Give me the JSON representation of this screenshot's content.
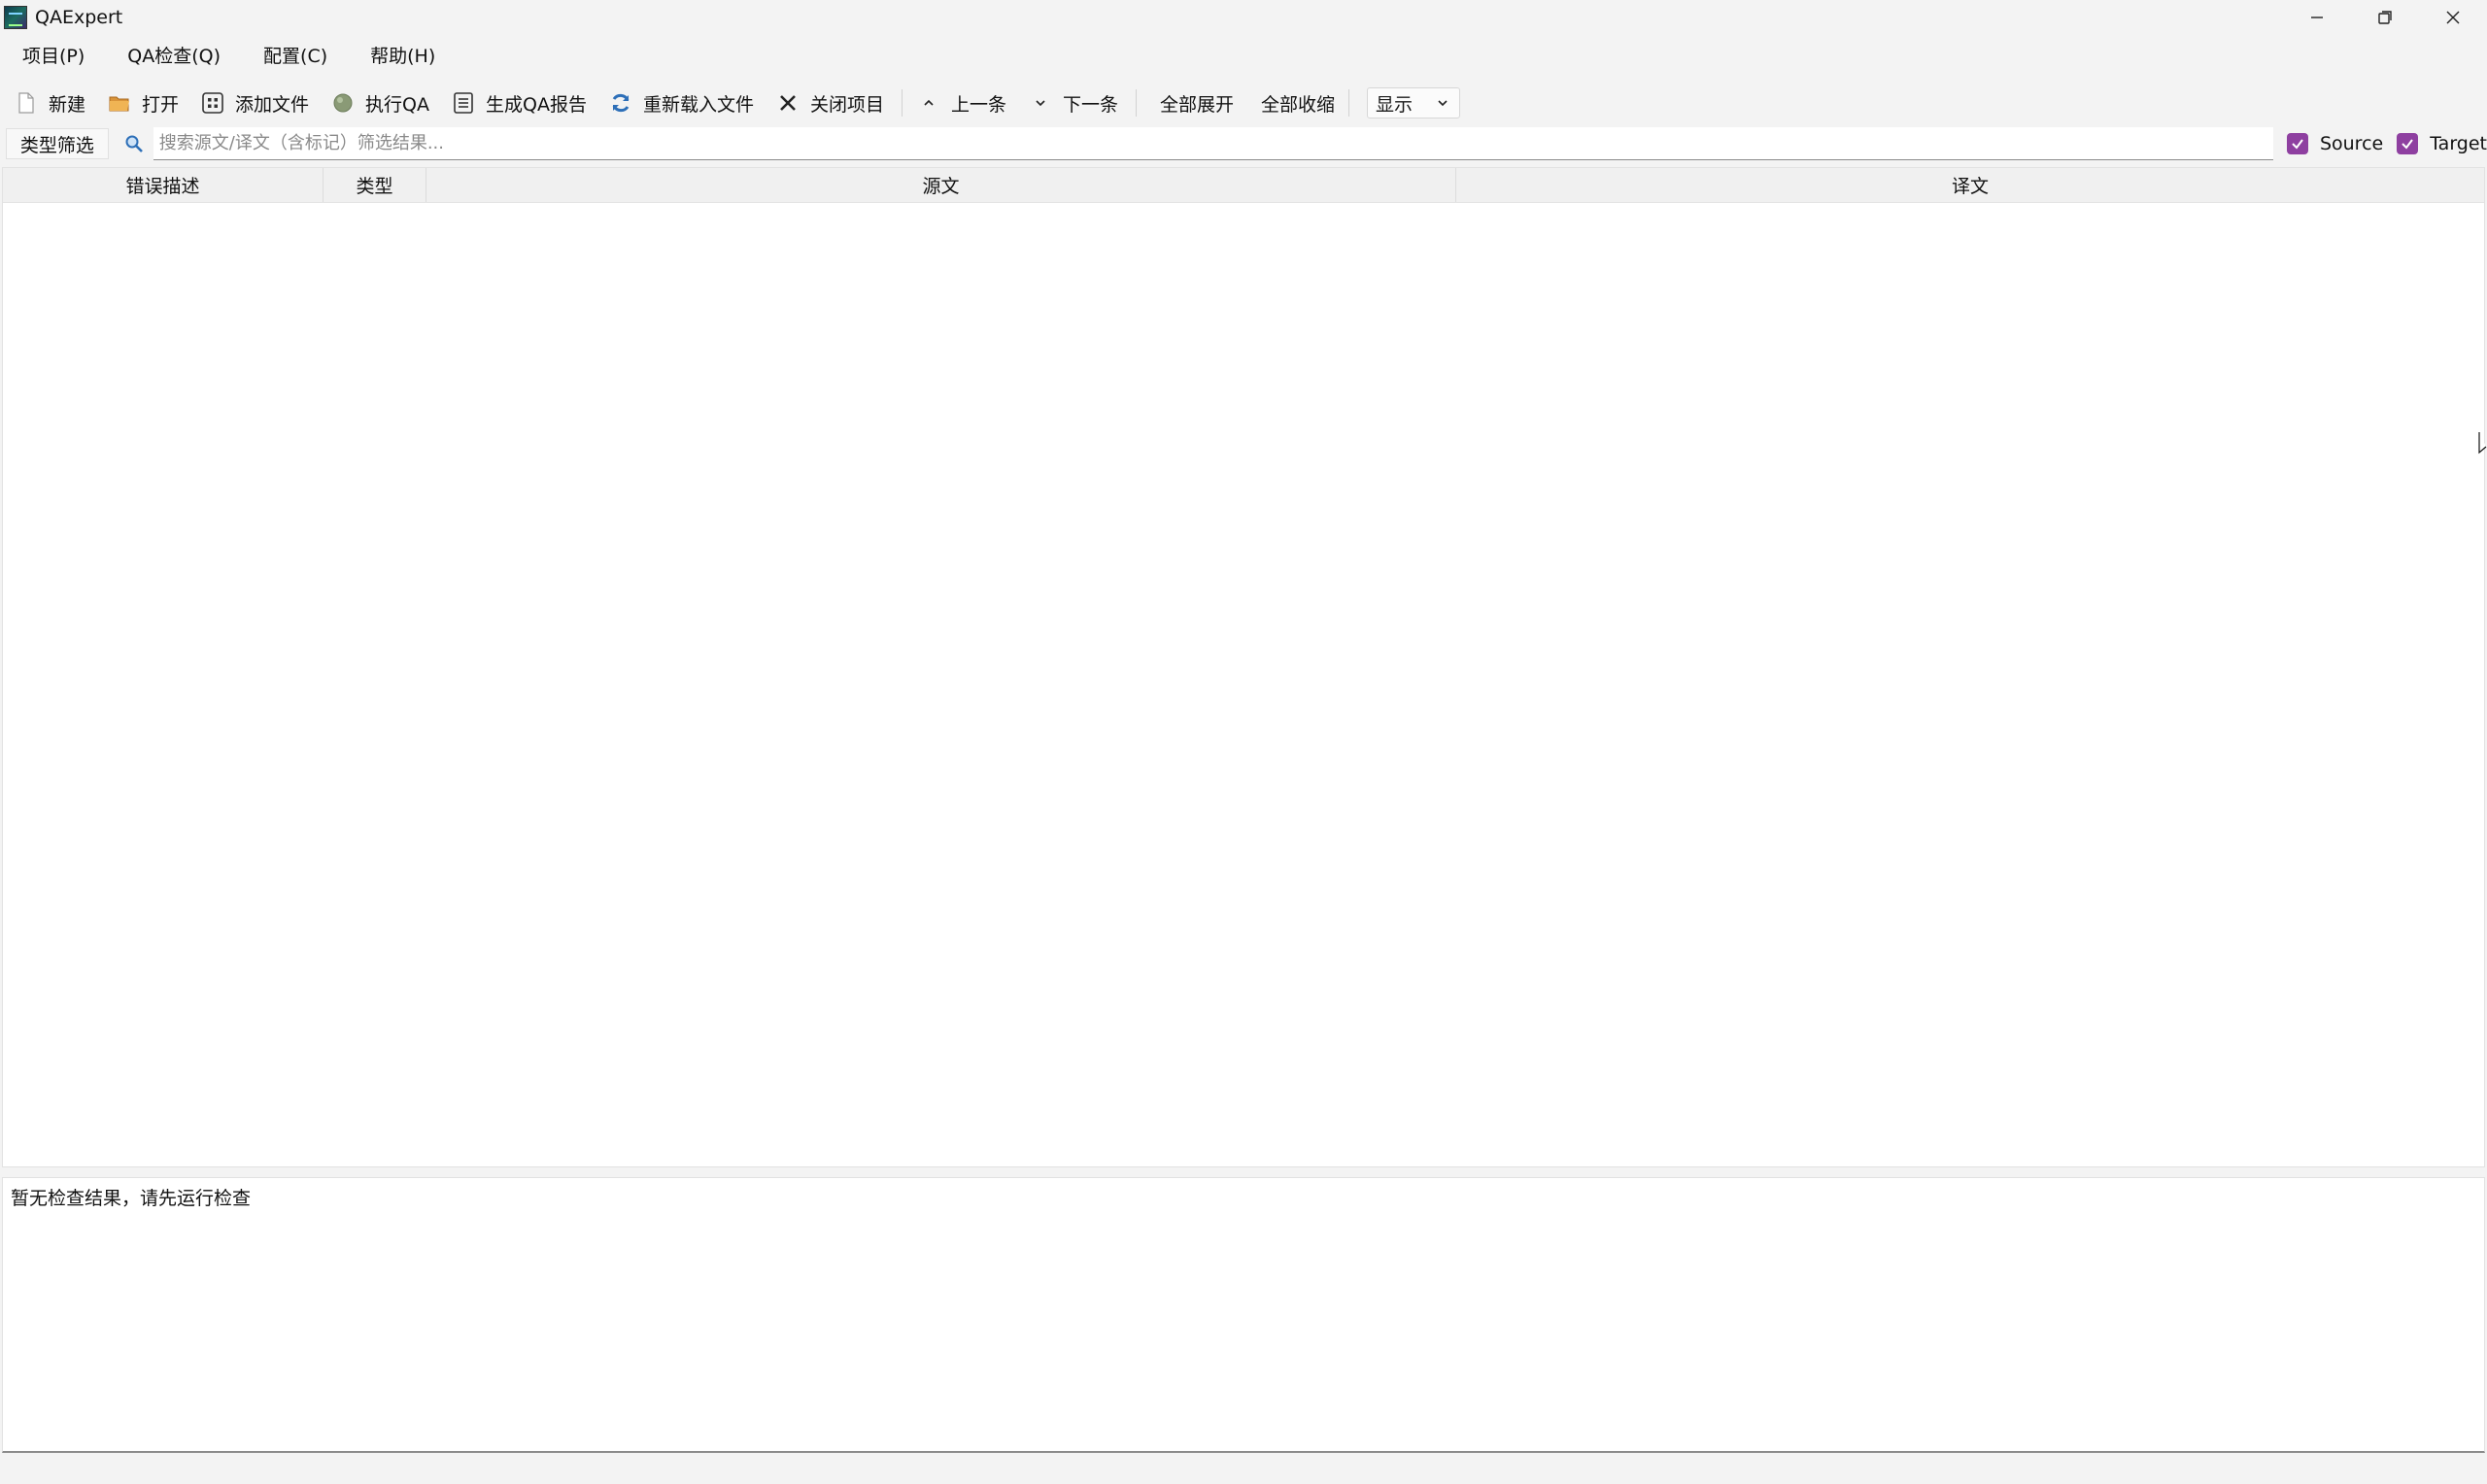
{
  "window": {
    "title": "QAExpert"
  },
  "menu": [
    {
      "label": "项目(P)"
    },
    {
      "label": "QA检查(Q)"
    },
    {
      "label": "配置(C)"
    },
    {
      "label": "帮助(H)"
    }
  ],
  "toolbar": {
    "new_label": "新建",
    "open_label": "打开",
    "add_file_label": "添加文件",
    "run_qa_label": "执行QA",
    "report_label": "生成QA报告",
    "reload_label": "重新载入文件",
    "close_project_label": "关闭项目",
    "prev_label": "上一条",
    "next_label": "下一条",
    "expand_all_label": "全部展开",
    "collapse_all_label": "全部收缩",
    "display_select_value": "显示"
  },
  "filter": {
    "type_filter_label": "类型筛选",
    "search_placeholder": "搜索源文/译文（含标记）筛选结果...",
    "source_label": "Source",
    "source_checked": true,
    "target_label": "Target",
    "target_checked": true
  },
  "table": {
    "columns": [
      "错误描述",
      "类型",
      "源文",
      "译文"
    ],
    "rows": []
  },
  "detail": {
    "message": "暂无检查结果，请先运行检查"
  },
  "colors": {
    "checkbox_accent": "#8e3fa0",
    "background": "#f3f3f3"
  }
}
